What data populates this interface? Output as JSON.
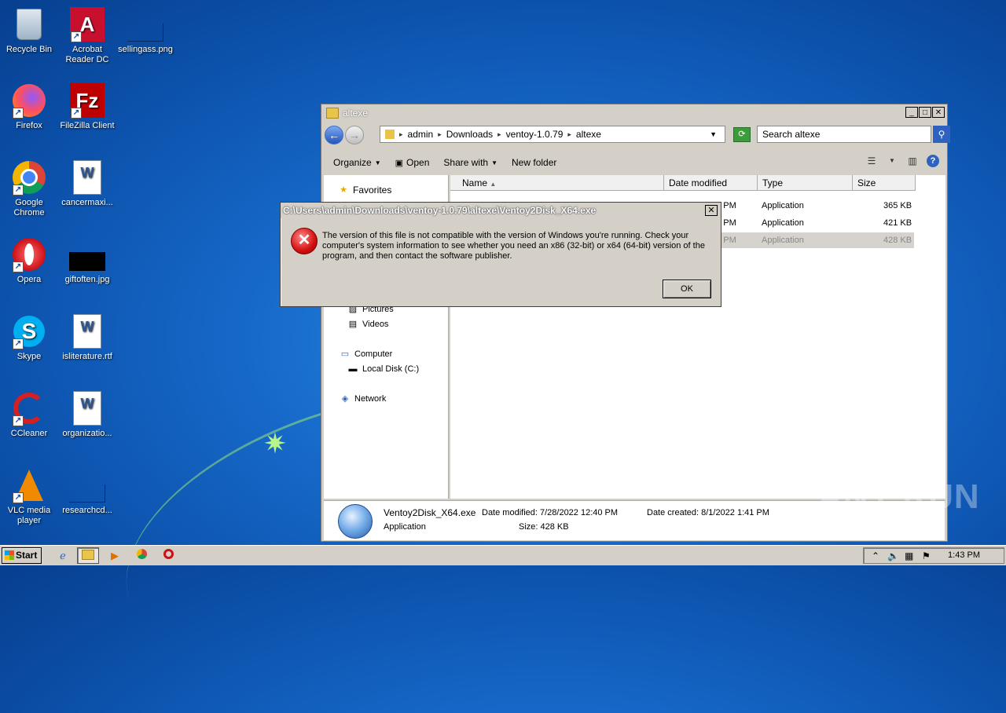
{
  "desktop": {
    "icons": [
      {
        "label": "Recycle Bin"
      },
      {
        "label": "Acrobat Reader DC"
      },
      {
        "label": "sellingass.png"
      },
      {
        "label": "Firefox"
      },
      {
        "label": "FileZilla Client"
      },
      {
        "label": "Google Chrome"
      },
      {
        "label": "cancermaxi..."
      },
      {
        "label": "Opera"
      },
      {
        "label": "giftoften.jpg"
      },
      {
        "label": "Skype"
      },
      {
        "label": "isliterature.rtf"
      },
      {
        "label": "CCleaner"
      },
      {
        "label": "organizatio..."
      },
      {
        "label": "VLC media player"
      },
      {
        "label": "researchcd..."
      }
    ]
  },
  "explorer": {
    "title": "altexe",
    "breadcrumbs": [
      "admin",
      "Downloads",
      "ventoy-1.0.79",
      "altexe"
    ],
    "search_placeholder": "Search altexe",
    "toolbar": {
      "organize": "Organize",
      "open": "Open",
      "share_with": "Share with",
      "new_folder": "New folder"
    },
    "nav": {
      "favorites": "Favorites",
      "pictures": "Pictures",
      "videos": "Videos",
      "computer": "Computer",
      "local_disk": "Local Disk (C:)",
      "network": "Network"
    },
    "columns": [
      "Name",
      "Date modified",
      "Type",
      "Size"
    ],
    "rows": [
      {
        "date": "40 PM",
        "type": "Application",
        "size": "365 KB"
      },
      {
        "date": "40 PM",
        "type": "Application",
        "size": "421 KB"
      },
      {
        "date": "40 PM",
        "type": "Application",
        "size": "428 KB"
      }
    ],
    "details": {
      "filename": "Ventoy2Disk_X64.exe",
      "date_modified": "Date modified: 7/28/2022 12:40 PM",
      "date_created": "Date created: 8/1/2022 1:41 PM",
      "type": "Application",
      "size": "Size: 428 KB"
    }
  },
  "dialog": {
    "title": "C:\\Users\\admin\\Downloads\\ventoy-1.0.79\\altexe\\Ventoy2Disk_X64.exe",
    "message": "The version of this file is not compatible with the version of Windows you're running. Check your computer's system information to see whether you need an x86 (32-bit) or x64 (64-bit) version of the program, and then contact the software publisher.",
    "ok": "OK",
    "close": "✕"
  },
  "taskbar": {
    "start": "Start",
    "clock": "1:43 PM"
  },
  "watermark": "ANY RUN"
}
